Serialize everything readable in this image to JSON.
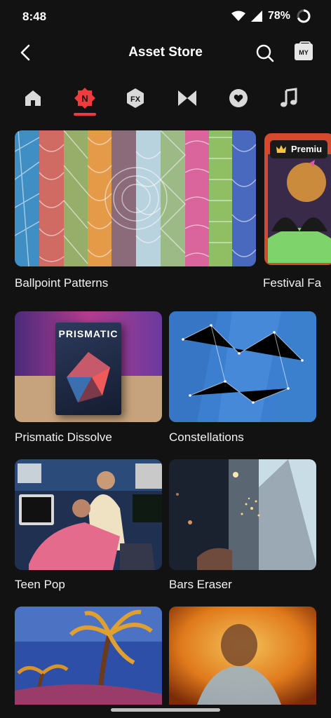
{
  "status_bar": {
    "time": "8:48",
    "battery": "78%"
  },
  "header": {
    "title": "Asset Store",
    "my_label": "MY"
  },
  "tabs": [
    {
      "icon": "home-icon",
      "active": false
    },
    {
      "icon": "new-icon",
      "active": true,
      "text": "N"
    },
    {
      "icon": "fx-icon",
      "active": false,
      "text": "FX"
    },
    {
      "icon": "transition-icon",
      "active": false
    },
    {
      "icon": "sticker-icon",
      "active": false
    },
    {
      "icon": "music-icon",
      "active": false
    }
  ],
  "featured": [
    {
      "label": "Ballpoint Patterns"
    },
    {
      "label": "Festival Fa",
      "badge": "Premiu"
    }
  ],
  "grid": [
    {
      "label": "Prismatic Dissolve",
      "box_title": "PRISMATIC"
    },
    {
      "label": "Constellations"
    },
    {
      "label": "Teen Pop"
    },
    {
      "label": "Bars Eraser"
    },
    {
      "label": ""
    },
    {
      "label": ""
    }
  ],
  "colors": {
    "background": "#121212",
    "accent": "#ee3b3b"
  }
}
